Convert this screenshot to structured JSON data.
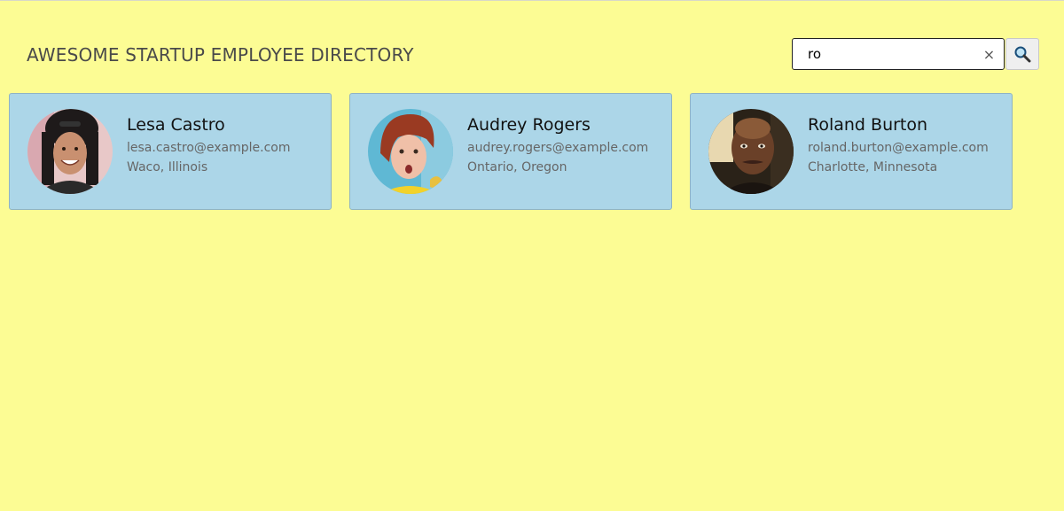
{
  "header": {
    "title": "AWESOME STARTUP EMPLOYEE DIRECTORY"
  },
  "search": {
    "value": "ro",
    "clear_symbol": "×",
    "clear_icon": "close-icon",
    "button_icon": "search-icon"
  },
  "employees": [
    {
      "name": "Lesa Castro",
      "email": "lesa.castro@example.com",
      "location": "Waco, Illinois"
    },
    {
      "name": "Audrey Rogers",
      "email": "audrey.rogers@example.com",
      "location": "Ontario, Oregon"
    },
    {
      "name": "Roland Burton",
      "email": "roland.burton@example.com",
      "location": "Charlotte, Minnesota"
    }
  ],
  "colors": {
    "page_background": "#fcfc94",
    "card_background": "#acd6e8"
  }
}
